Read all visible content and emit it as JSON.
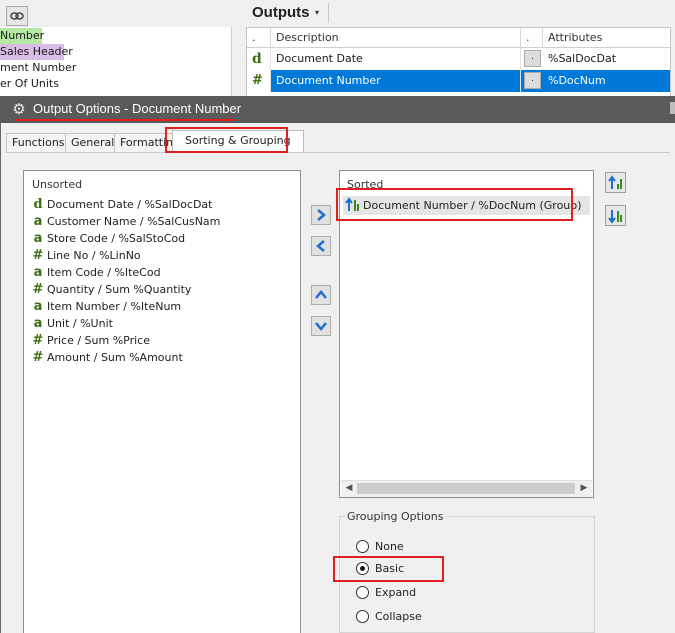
{
  "background": {
    "left_list_rows": [
      " Number",
      "Sales Header",
      "ment Number",
      "er Of Units"
    ],
    "outputs_title": "Outputs",
    "outputs_caret": "▾",
    "grid": {
      "headers": [
        ".",
        "Description",
        ".",
        "Attributes"
      ],
      "rows": [
        {
          "glyph": "d",
          "description": "Document Date",
          "dot": ".",
          "attribute": "%SalDocDat",
          "selected": false
        },
        {
          "glyph": "#",
          "description": "Document Number",
          "dot": ".",
          "attribute": "%DocNum",
          "selected": true
        }
      ]
    }
  },
  "dialog": {
    "title": "Output Options - Document Number",
    "tabs": [
      "Functions",
      "General",
      "Formatting",
      "Sorting & Grouping"
    ],
    "active_tab": "Sorting & Grouping",
    "unsorted": {
      "label": "Unsorted",
      "items": [
        {
          "glyph": "d",
          "name": "Document Date",
          "sep": " / ",
          "attr": "%SalDocDat"
        },
        {
          "glyph": "a",
          "name": "Customer Name",
          "sep": " / ",
          "attr": "%SalCusNam"
        },
        {
          "glyph": "a",
          "name": "Store Code",
          "sep": " / ",
          "attr": "%SalStoCod"
        },
        {
          "glyph": "#",
          "name": "Line No",
          "sep": " / ",
          "attr": "%LinNo"
        },
        {
          "glyph": "a",
          "name": "Item Code",
          "sep": " / ",
          "attr": "%IteCod"
        },
        {
          "glyph": "#",
          "name": "Quantity",
          "sep": " / ",
          "attr": "Sum %Quantity"
        },
        {
          "glyph": "a",
          "name": "Item Number",
          "sep": " / ",
          "attr": "%IteNum"
        },
        {
          "glyph": "a",
          "name": "Unit",
          "sep": " / ",
          "attr": "%Unit"
        },
        {
          "glyph": "#",
          "name": "Price",
          "sep": " / ",
          "attr": "Sum %Price"
        },
        {
          "glyph": "#",
          "name": "Amount",
          "sep": " / ",
          "attr": "Sum %Amount"
        }
      ]
    },
    "sorted": {
      "label": "Sorted",
      "items": [
        {
          "text": "Document Number  /  %DocNum (Group)"
        }
      ]
    },
    "grouping": {
      "label": "Grouping Options",
      "options": [
        "None",
        "Basic",
        "Expand",
        "Collapse"
      ],
      "selected": "Basic"
    },
    "colors": {
      "titlebar": "#5a5a5a",
      "highlight": "#e0201f",
      "glyph": "#3b6f14",
      "arrow_blue": "#1e6fd0"
    }
  }
}
